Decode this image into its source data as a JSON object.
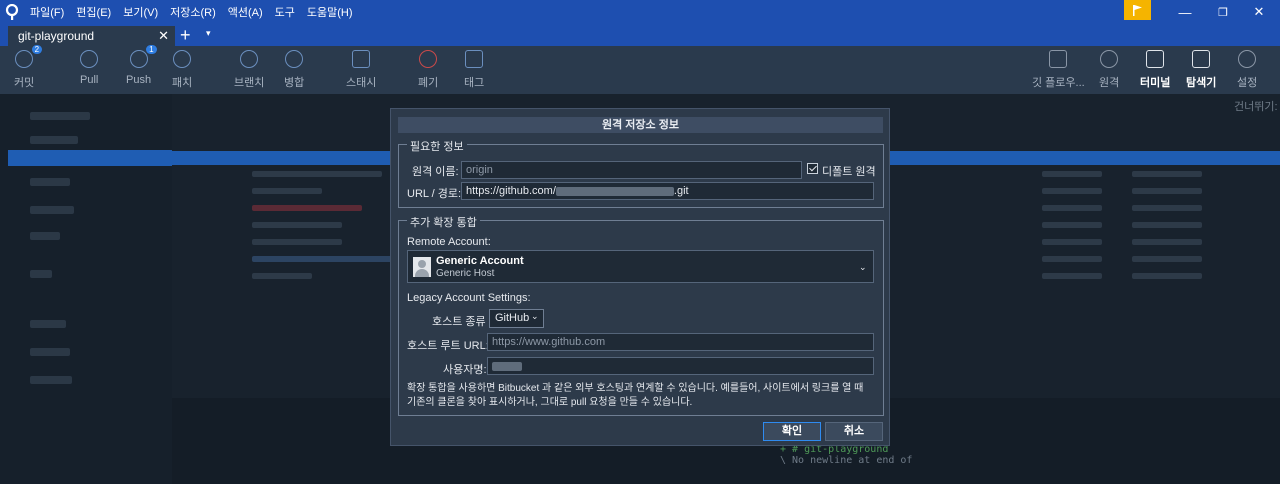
{
  "menu": [
    "파일(F)",
    "편집(E)",
    "보기(V)",
    "저장소(R)",
    "액션(A)",
    "도구",
    "도움말(H)"
  ],
  "window_controls": {
    "minimize": "—",
    "maximize": "❐",
    "close": "✕"
  },
  "tab": {
    "label": "git-playground",
    "close": "✕",
    "add": "+",
    "more": "▾"
  },
  "toolbar": {
    "commit": {
      "label": "커밋",
      "badge": "2"
    },
    "pull": {
      "label": "Pull"
    },
    "push": {
      "label": "Push",
      "badge": "1"
    },
    "fetch": {
      "label": "패치"
    },
    "branch": {
      "label": "브랜치"
    },
    "merge": {
      "label": "병합"
    },
    "stash": {
      "label": "스태시"
    },
    "discard": {
      "label": "폐기"
    },
    "tag": {
      "label": "태그"
    },
    "gitflow": {
      "label": "깃 플로우..."
    },
    "remote": {
      "label": "원격"
    },
    "terminal": {
      "label": "터미널"
    },
    "explorer": {
      "label": "탐색기"
    },
    "settings": {
      "label": "설정"
    }
  },
  "background": {
    "skip_label": "건너뛰기:",
    "diff_line_1": "+ # git-playground",
    "diff_line_2": "\\ No newline at end of"
  },
  "dialog": {
    "title": "원격 저장소 정보",
    "required_legend": "필요한 정보",
    "remote_name_label": "원격 이름:",
    "remote_name_placeholder": "origin",
    "default_remote_label": "디폴트 원격",
    "url_label": "URL / 경로:",
    "url_prefix": "https://github.com/",
    "url_suffix": ".git",
    "extended_legend": "추가 확장 통합",
    "remote_account_label": "Remote Account:",
    "account_name": "Generic Account",
    "account_host": "Generic Host",
    "legacy_label": "Legacy Account Settings:",
    "host_type_label": "호스트 종류",
    "host_type_value": "GitHub",
    "host_root_label": "호스트 루트 URL:",
    "host_root_placeholder": "https://www.github.com",
    "username_label": "사용자명:",
    "description_line1": "확장 통합을 사용하면 Bitbucket 과 같은 외부 호스팅과 연계할 수 있습니다. 예를들어, 사이트에서 링크를 열 때",
    "description_line2": "기존의 클론을 찾아 표시하거나, 그대로 pull 요청을 만들 수 있습니다.",
    "ok_label": "확인",
    "cancel_label": "취소"
  }
}
